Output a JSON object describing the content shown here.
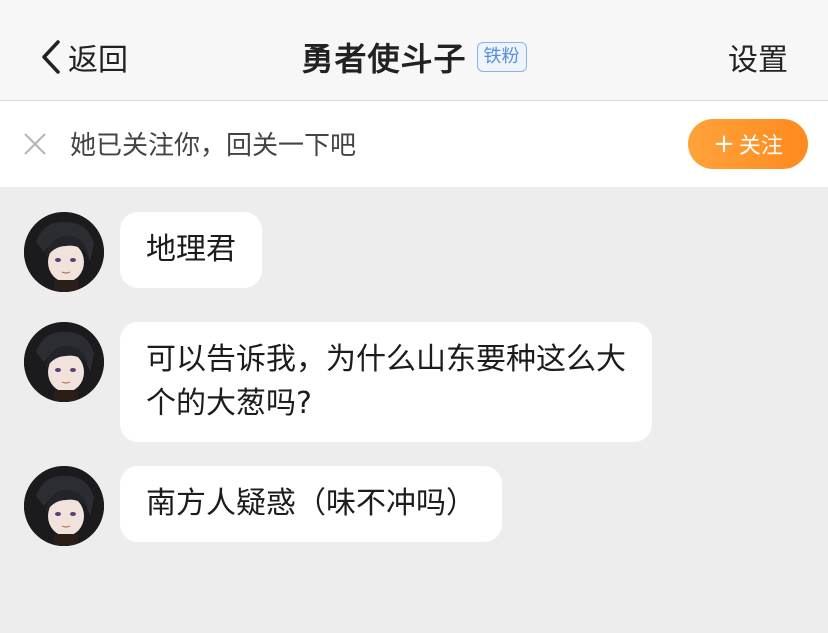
{
  "header": {
    "back_label": "返回",
    "title": "勇者使斗子",
    "badge": "铁粉",
    "settings_label": "设置"
  },
  "follow_bar": {
    "text": "她已关注你，回关一下吧",
    "button_label": "关注"
  },
  "messages": [
    {
      "text": "地理君"
    },
    {
      "text_line1": "可以告诉我，为什么山东要种这么大",
      "text_line2": "个的大葱吗?"
    },
    {
      "text": "南方人疑惑（味不冲吗）"
    }
  ],
  "colors": {
    "accent_orange": "#ff9a2e",
    "badge_blue": "#5b8ed8",
    "background": "#ededed"
  }
}
